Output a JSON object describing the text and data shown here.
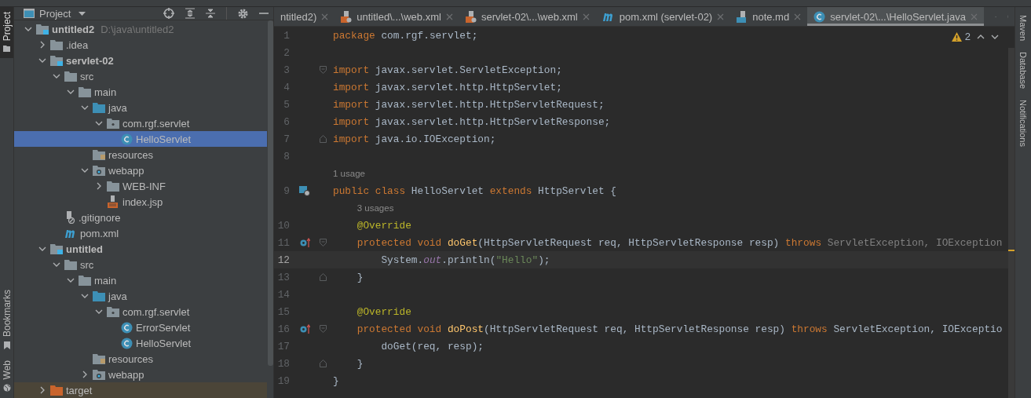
{
  "left_stripe": [
    {
      "label": "Project",
      "kind": "project",
      "selected": true
    },
    {
      "label": "Bookmarks",
      "kind": "bookmarks",
      "selected": false
    },
    {
      "label": "Web",
      "kind": "web",
      "selected": false
    }
  ],
  "project": {
    "title": "Project",
    "tree": [
      {
        "label": "untitled2",
        "path": "D:\\java\\untitled2",
        "kind": "module",
        "expanded": true,
        "selected": false,
        "children": [
          {
            "label": ".idea",
            "kind": "folder",
            "expanded": false,
            "selected": false
          },
          {
            "label": "servlet-02",
            "kind": "module",
            "expanded": true,
            "selected": false,
            "children": [
              {
                "label": "src",
                "kind": "folder",
                "expanded": true,
                "selected": false,
                "children": [
                  {
                    "label": "main",
                    "kind": "folder",
                    "expanded": true,
                    "selected": false,
                    "children": [
                      {
                        "label": "java",
                        "kind": "source",
                        "expanded": true,
                        "selected": false,
                        "children": [
                          {
                            "label": "com.rgf.servlet",
                            "kind": "package",
                            "expanded": true,
                            "selected": false,
                            "children": [
                              {
                                "label": "HelloServlet",
                                "kind": "class",
                                "selected": true
                              }
                            ]
                          }
                        ]
                      },
                      {
                        "label": "resources",
                        "kind": "resources",
                        "selected": false
                      },
                      {
                        "label": "webapp",
                        "kind": "web",
                        "expanded": true,
                        "selected": false,
                        "children": [
                          {
                            "label": "WEB-INF",
                            "kind": "folder",
                            "expanded": false,
                            "selected": false
                          },
                          {
                            "label": "index.jsp",
                            "kind": "jsp",
                            "selected": false
                          }
                        ]
                      }
                    ]
                  }
                ]
              },
              {
                "label": ".gitignore",
                "kind": "gitignore",
                "selected": false
              },
              {
                "label": "pom.xml",
                "kind": "maven",
                "selected": false
              }
            ]
          },
          {
            "label": "untitled",
            "kind": "module",
            "expanded": true,
            "selected": false,
            "children": [
              {
                "label": "src",
                "kind": "folder",
                "expanded": true,
                "selected": false,
                "children": [
                  {
                    "label": "main",
                    "kind": "folder",
                    "expanded": true,
                    "selected": false,
                    "children": [
                      {
                        "label": "java",
                        "kind": "source",
                        "expanded": true,
                        "selected": false,
                        "children": [
                          {
                            "label": "com.rgf.servlet",
                            "kind": "package",
                            "expanded": true,
                            "selected": false,
                            "children": [
                              {
                                "label": "ErrorServlet",
                                "kind": "class",
                                "selected": false
                              },
                              {
                                "label": "HelloServlet",
                                "kind": "class",
                                "selected": false
                              }
                            ]
                          }
                        ]
                      },
                      {
                        "label": "resources",
                        "kind": "resources",
                        "selected": false
                      },
                      {
                        "label": "webapp",
                        "kind": "web",
                        "expanded": false,
                        "selected": false
                      }
                    ]
                  }
                ]
              }
            ]
          },
          {
            "label": "target",
            "kind": "excluded",
            "expanded": false,
            "selected": false
          }
        ]
      }
    ]
  },
  "tabs": [
    {
      "label": "ntitled2)",
      "selected": false
    },
    {
      "label": "untitled\\...\\web.xml",
      "kind": "xml",
      "selected": false
    },
    {
      "label": "servlet-02\\...\\web.xml",
      "kind": "xml",
      "selected": false
    },
    {
      "label": "pom.xml (servlet-02)",
      "kind": "maven",
      "selected": false
    },
    {
      "label": "note.md",
      "kind": "markdown",
      "selected": false
    },
    {
      "label": "servlet-02\\...\\HelloServlet.java",
      "kind": "class",
      "selected": true
    }
  ],
  "editor": {
    "warnings": "2",
    "lines": [
      {
        "kind": "code",
        "number": "1",
        "tokens": [
          {
            "text": "package",
            "kind": "keyword"
          },
          {
            "text": " com.rgf.servlet;",
            "kind": "plain"
          }
        ]
      },
      {
        "kind": "code",
        "number": "2"
      },
      {
        "kind": "code",
        "number": "3",
        "gutter": [
          {
            "kind": "fold-start"
          }
        ],
        "tokens": [
          {
            "text": "import",
            "kind": "keyword"
          },
          {
            "text": " javax.servlet.ServletException;",
            "kind": "plain"
          }
        ]
      },
      {
        "kind": "code",
        "number": "4",
        "tokens": [
          {
            "text": "import",
            "kind": "keyword"
          },
          {
            "text": " javax.servlet.http.HttpServlet;",
            "kind": "plain"
          }
        ]
      },
      {
        "kind": "code",
        "number": "5",
        "tokens": [
          {
            "text": "import",
            "kind": "keyword"
          },
          {
            "text": " javax.servlet.http.HttpServletRequest;",
            "kind": "plain"
          }
        ]
      },
      {
        "kind": "code",
        "number": "6",
        "tokens": [
          {
            "text": "import",
            "kind": "keyword"
          },
          {
            "text": " javax.servlet.http.HttpServletResponse;",
            "kind": "plain"
          }
        ]
      },
      {
        "kind": "code",
        "number": "7",
        "gutter": [
          {
            "kind": "fold-end"
          }
        ],
        "tokens": [
          {
            "text": "import",
            "kind": "keyword"
          },
          {
            "text": " java.io.IOException;",
            "kind": "plain"
          }
        ]
      },
      {
        "kind": "code",
        "number": "8"
      },
      {
        "kind": "hint",
        "text": "1 usage"
      },
      {
        "kind": "code",
        "number": "9",
        "gutter": [
          {
            "kind": "servlet"
          }
        ],
        "tokens": [
          {
            "text": "public class",
            "kind": "keyword"
          },
          {
            "text": " HelloServlet ",
            "kind": "plain"
          },
          {
            "text": "extends",
            "kind": "keyword"
          },
          {
            "text": " HttpServlet {",
            "kind": "plain"
          }
        ]
      },
      {
        "kind": "hint",
        "text": "3 usages"
      },
      {
        "kind": "code",
        "number": "10",
        "tokens": [
          {
            "text": "    @Override",
            "kind": "annotation"
          }
        ]
      },
      {
        "kind": "code",
        "number": "11",
        "gutter": [
          {
            "kind": "override"
          },
          {
            "kind": "fold-start"
          }
        ],
        "tokens": [
          {
            "text": "    protected void ",
            "kind": "keyword"
          },
          {
            "text": "doGet",
            "kind": "method"
          },
          {
            "text": "(HttpServletRequest req, HttpServletResponse resp) ",
            "kind": "plain"
          },
          {
            "text": "throws",
            "kind": "keyword"
          },
          {
            "text": " ServletException, IOException",
            "kind": "dim"
          }
        ]
      },
      {
        "kind": "code",
        "number": "12",
        "current": true,
        "tokens": [
          {
            "text": "        System.",
            "kind": "plain"
          },
          {
            "text": "out",
            "kind": "static"
          },
          {
            "text": ".println(",
            "kind": "plain"
          },
          {
            "text": "\"Hello\"",
            "kind": "string"
          },
          {
            "text": ");",
            "kind": "plain"
          }
        ]
      },
      {
        "kind": "code",
        "number": "13",
        "gutter": [
          {
            "kind": "fold-end"
          }
        ],
        "tokens": [
          {
            "text": "    }",
            "kind": "plain"
          }
        ]
      },
      {
        "kind": "code",
        "number": "14"
      },
      {
        "kind": "code",
        "number": "15",
        "tokens": [
          {
            "text": "    @Override",
            "kind": "annotation"
          }
        ]
      },
      {
        "kind": "code",
        "number": "16",
        "gutter": [
          {
            "kind": "override"
          },
          {
            "kind": "fold-start"
          }
        ],
        "tokens": [
          {
            "text": "    protected void ",
            "kind": "keyword"
          },
          {
            "text": "doPost",
            "kind": "method"
          },
          {
            "text": "(HttpServletRequest req, HttpServletResponse resp) ",
            "kind": "plain"
          },
          {
            "text": "throws",
            "kind": "keyword"
          },
          {
            "text": " ServletException, IOExceptio",
            "kind": "plain"
          }
        ]
      },
      {
        "kind": "code",
        "number": "17",
        "tokens": [
          {
            "text": "        doGet(req, resp);",
            "kind": "plain"
          }
        ]
      },
      {
        "kind": "code",
        "number": "18",
        "gutter": [
          {
            "kind": "fold-end"
          }
        ],
        "tokens": [
          {
            "text": "    }",
            "kind": "plain"
          }
        ]
      },
      {
        "kind": "code",
        "number": "19",
        "tokens": [
          {
            "text": "}",
            "kind": "plain"
          }
        ]
      }
    ]
  },
  "right_stripe": [
    {
      "label": "Maven"
    },
    {
      "label": "Database"
    },
    {
      "label": "Notifications"
    }
  ]
}
